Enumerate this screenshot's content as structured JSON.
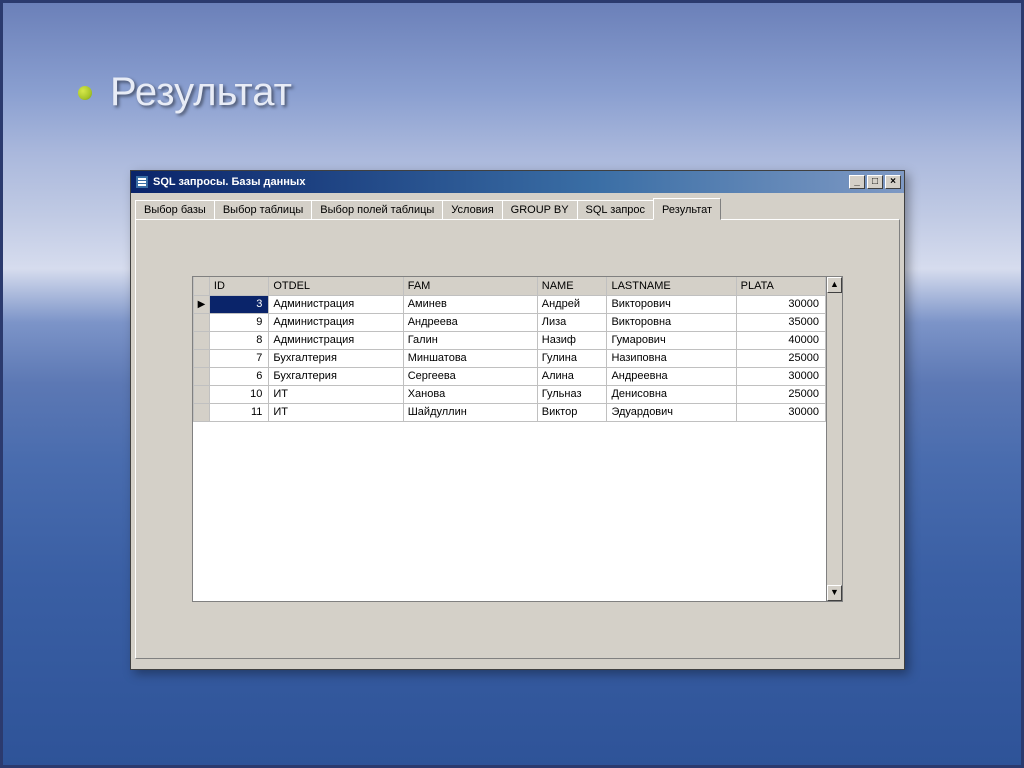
{
  "slide": {
    "title": "Результат"
  },
  "window": {
    "title": "SQL запросы. Базы данных"
  },
  "tabs": [
    {
      "label": "Выбор базы"
    },
    {
      "label": "Выбор таблицы"
    },
    {
      "label": "Выбор полей таблицы"
    },
    {
      "label": "Условия"
    },
    {
      "label": "GROUP BY"
    },
    {
      "label": "SQL запрос"
    },
    {
      "label": "Результат"
    }
  ],
  "active_tab": "Результат",
  "columns": [
    "ID",
    "OTDEL",
    "FAM",
    "NAME",
    "LASTNAME",
    "PLATA"
  ],
  "rows": [
    {
      "id": 3,
      "otdel": "Администрация",
      "fam": "Аминев",
      "name": "Андрей",
      "lastname": "Викторович",
      "plata": 30000,
      "current": true
    },
    {
      "id": 9,
      "otdel": "Администрация",
      "fam": "Андреева",
      "name": "Лиза",
      "lastname": "Викторовна",
      "plata": 35000
    },
    {
      "id": 8,
      "otdel": "Администрация",
      "fam": "Галин",
      "name": "Назиф",
      "lastname": "Гумарович",
      "plata": 40000
    },
    {
      "id": 7,
      "otdel": "Бухгалтерия",
      "fam": "Миншатова",
      "name": "Гулина",
      "lastname": "Назиповна",
      "plata": 25000
    },
    {
      "id": 6,
      "otdel": "Бухгалтерия",
      "fam": "Сергеева",
      "name": "Алина",
      "lastname": "Андреевна",
      "plata": 30000
    },
    {
      "id": 10,
      "otdel": "ИТ",
      "fam": "Ханова",
      "name": "Гульназ",
      "lastname": "Денисовна",
      "plata": 25000
    },
    {
      "id": 11,
      "otdel": "ИТ",
      "fam": "Шайдуллин",
      "name": "Виктор",
      "lastname": "Эдуардович",
      "plata": 30000
    }
  ]
}
